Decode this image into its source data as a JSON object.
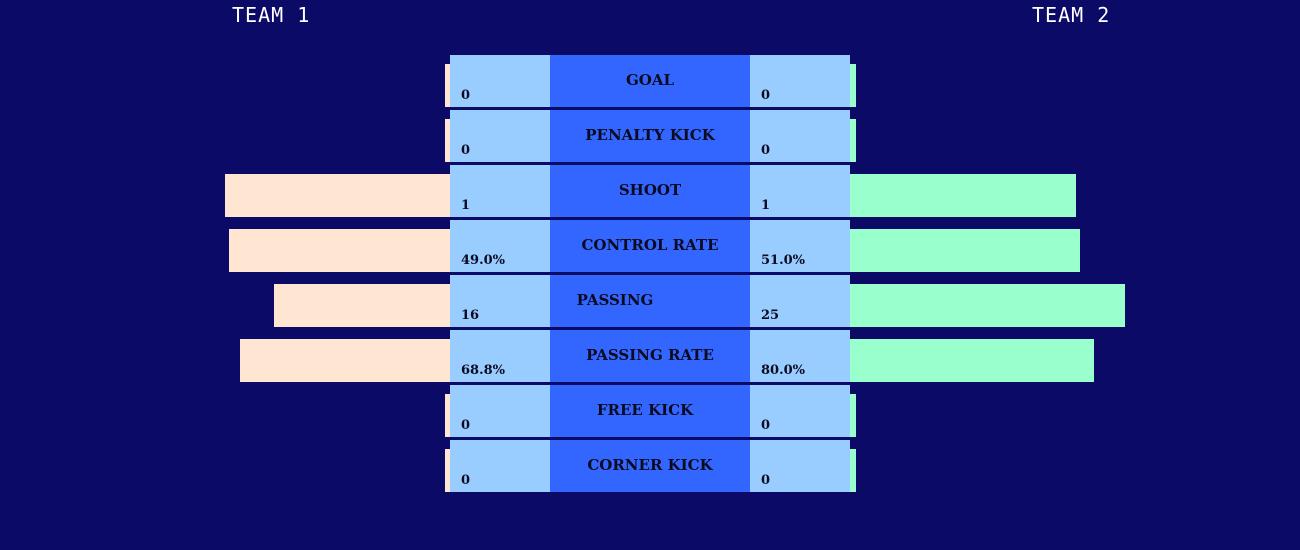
{
  "teams": {
    "left": "TEAM 1",
    "right": "TEAM 2"
  },
  "colors": {
    "background": "#0b0a66",
    "value_cell": "#99ccff",
    "label_cell": "#3366ff",
    "team1_bar": "#ffe6d3",
    "team2_bar": "#99ffcc"
  },
  "stats": [
    {
      "label": "GOAL",
      "team1": "0",
      "team2": "0"
    },
    {
      "label": "PENALTY KICK",
      "team1": "0",
      "team2": "0"
    },
    {
      "label": "SHOOT",
      "team1": "1",
      "team2": "1"
    },
    {
      "label": "CONTROL RATE",
      "team1": "49.0%",
      "team2": "51.0%"
    },
    {
      "label": "PASSING",
      "team1": "16",
      "team2": "25"
    },
    {
      "label": "PASSING RATE",
      "team1": "68.8%",
      "team2": "80.0%"
    },
    {
      "label": "FREE KICK",
      "team1": "0",
      "team2": "0"
    },
    {
      "label": "CORNER KICK",
      "team1": "0",
      "team2": "0"
    }
  ]
}
